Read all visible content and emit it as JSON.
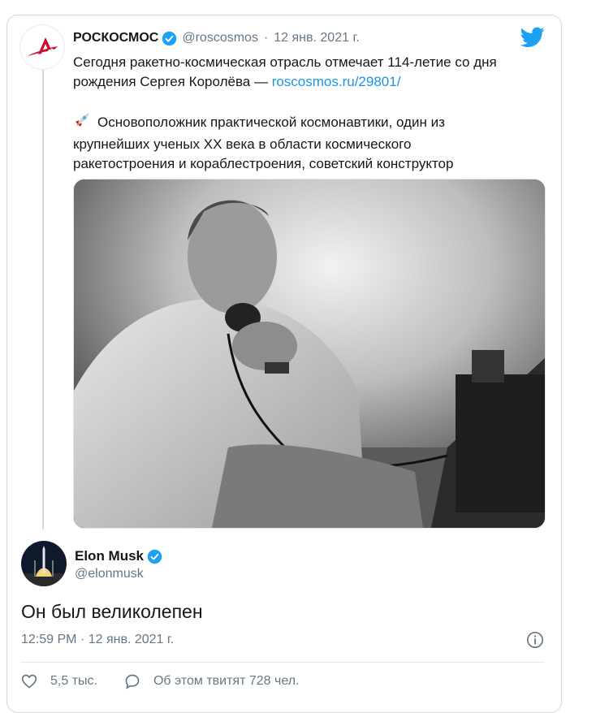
{
  "quoted_tweet": {
    "author_name": "РОСКОСМОС",
    "handle": "@roscosmos",
    "separator": "·",
    "date": "12 янв. 2021 г.",
    "line1": "Сегодня ракетно-космическая отрасль отмечает 114-летие со дня",
    "line2_prefix": "рождения Сергея Королёва — ",
    "link": "roscosmos.ru/29801/",
    "para2_line1": "Основоположник практической космонавтики, один из",
    "para2_line2": "крупнейших ученых XX века в области космического",
    "para2_line3": "ракетостроения и кораблестроения, советский конструктор",
    "emoji": "rocket-emoji",
    "avatar_icon": "roscosmos-logo-icon"
  },
  "main_tweet": {
    "author_name": "Elon Musk",
    "handle": "@elonmusk",
    "text": "Он был великолепен",
    "time": "12:59 PM",
    "separator": "·",
    "date": "12 янв. 2021 г.",
    "avatar_icon": "rocket-launch-avatar"
  },
  "actions": {
    "likes": "5,5 тыс.",
    "discussion": "Об этом твитят 728 чел."
  },
  "icons": {
    "brand": "twitter-bird-icon",
    "verified": "verified-badge-icon",
    "info": "info-icon",
    "like": "heart-icon",
    "reply": "speech-bubble-icon"
  },
  "colors": {
    "link": "#1b95e0",
    "verified": "#1da1f2",
    "muted": "#657786",
    "border": "#cfd9de"
  }
}
